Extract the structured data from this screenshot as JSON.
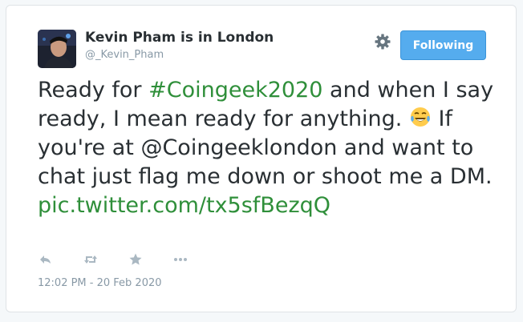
{
  "author": {
    "name": "Kevin Pham is in London",
    "handle": "@_Kevin_Pham"
  },
  "header": {
    "follow_label": "Following",
    "settings_icon": "gear-icon"
  },
  "tweet": {
    "text_part1": "Ready for ",
    "hashtag": "#Coingeek2020",
    "text_part2": " and when I say ready, I mean ready for anything. ",
    "emoji": "tears-of-joy-emoji",
    "text_part3": " If you're at @Coingeeklondon and want to chat just flag me down or shoot me a DM.",
    "pic_link": "pic.twitter.com/tx5sfBezqQ"
  },
  "actions": [
    "reply-icon",
    "retweet-icon",
    "favorite-icon",
    "more-icon"
  ],
  "timestamp": "12:02 PM - 20 Feb 2020",
  "colors": {
    "link": "#2f8f3a",
    "follow_button": "#55acee",
    "text": "#292f33",
    "muted": "#8899a6"
  }
}
